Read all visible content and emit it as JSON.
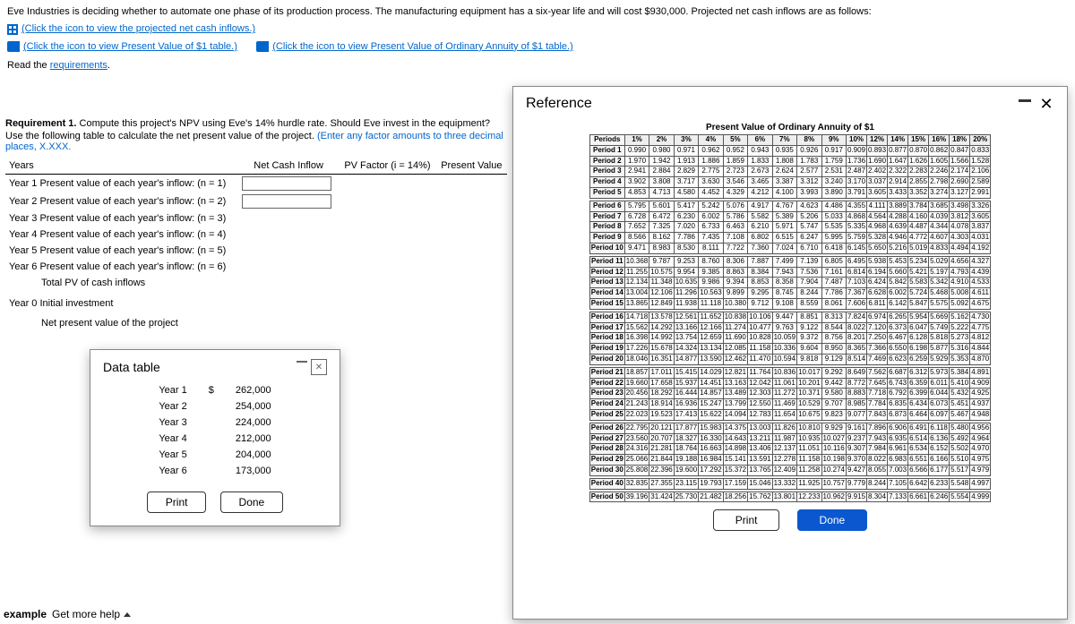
{
  "problem": {
    "intro": "Eve Industries is deciding whether to automate one phase of its production process. The manufacturing equipment has a six-year life and will cost $930,000. Projected net cash inflows are as follows:",
    "link_cash_inflows": "(Click the icon to view the projected net cash inflows.)",
    "link_pv1": "(Click the icon to view Present Value of $1 table.)",
    "link_pv_annuity": "(Click the icon to view Present Value of Ordinary Annuity of $1 table.)",
    "read_reqs": "Read the ",
    "reqs_link": "requirements",
    "req1_label": "Requirement 1.",
    "req1_text": " Compute this project's NPV using Eve's 14% hurdle rate. Should Eve invest in the equipment?",
    "instr": "Use the following table to calculate the net present value of the project. ",
    "instr_hint": "(Enter any factor amounts to three decimal places, X.XXX."
  },
  "headers": {
    "years": "Years",
    "ncf": "Net Cash Inflow",
    "pvf": "PV Factor (i = 14%)",
    "pv": "Present Value"
  },
  "rows": [
    "Year 1  Present value of each year's inflow: (n = 1)",
    "Year 2  Present value of each year's inflow: (n = 2)",
    "Year 3  Present value of each year's inflow: (n = 3)",
    "Year 4  Present value of each year's inflow: (n = 4)",
    "Year 5  Present value of each year's inflow: (n = 5)",
    "Year 6  Present value of each year's inflow: (n = 6)"
  ],
  "totals": {
    "totpv": "Total PV of cash inflows",
    "y0": "Year 0  Initial investment",
    "npv": "Net present value of the project"
  },
  "datatable": {
    "title": "Data table",
    "rows": [
      [
        "Year 1",
        "$",
        "262,000"
      ],
      [
        "Year 2",
        "",
        "254,000"
      ],
      [
        "Year 3",
        "",
        "224,000"
      ],
      [
        "Year 4",
        "",
        "212,000"
      ],
      [
        "Year 5",
        "",
        "204,000"
      ],
      [
        "Year 6",
        "",
        "173,000"
      ]
    ],
    "print": "Print",
    "done": "Done"
  },
  "reference": {
    "title": "Reference",
    "table_title": "Present Value of Ordinary Annuity of $1",
    "cols": [
      "Periods",
      "1%",
      "2%",
      "3%",
      "4%",
      "5%",
      "6%",
      "7%",
      "8%",
      "9%",
      "10%",
      "12%",
      "14%",
      "15%",
      "16%",
      "18%",
      "20%"
    ],
    "groups": [
      [
        [
          "Period 1",
          "0.990",
          "0.980",
          "0.971",
          "0.962",
          "0.952",
          "0.943",
          "0.935",
          "0.926",
          "0.917",
          "0.909",
          "0.893",
          "0.877",
          "0.870",
          "0.862",
          "0.847",
          "0.833"
        ],
        [
          "Period 2",
          "1.970",
          "1.942",
          "1.913",
          "1.886",
          "1.859",
          "1.833",
          "1.808",
          "1.783",
          "1.759",
          "1.736",
          "1.690",
          "1.647",
          "1.626",
          "1.605",
          "1.566",
          "1.528"
        ],
        [
          "Period 3",
          "2.941",
          "2.884",
          "2.829",
          "2.775",
          "2.723",
          "2.673",
          "2.624",
          "2.577",
          "2.531",
          "2.487",
          "2.402",
          "2.322",
          "2.283",
          "2.246",
          "2.174",
          "2.106"
        ],
        [
          "Period 4",
          "3.902",
          "3.808",
          "3.717",
          "3.630",
          "3.546",
          "3.465",
          "3.387",
          "3.312",
          "3.240",
          "3.170",
          "3.037",
          "2.914",
          "2.855",
          "2.798",
          "2.690",
          "2.589"
        ],
        [
          "Period 5",
          "4.853",
          "4.713",
          "4.580",
          "4.452",
          "4.329",
          "4.212",
          "4.100",
          "3.993",
          "3.890",
          "3.791",
          "3.605",
          "3.433",
          "3.352",
          "3.274",
          "3.127",
          "2.991"
        ]
      ],
      [
        [
          "Period 6",
          "5.795",
          "5.601",
          "5.417",
          "5.242",
          "5.076",
          "4.917",
          "4.767",
          "4.623",
          "4.486",
          "4.355",
          "4.111",
          "3.889",
          "3.784",
          "3.685",
          "3.498",
          "3.326"
        ],
        [
          "Period 7",
          "6.728",
          "6.472",
          "6.230",
          "6.002",
          "5.786",
          "5.582",
          "5.389",
          "5.206",
          "5.033",
          "4.868",
          "4.564",
          "4.288",
          "4.160",
          "4.039",
          "3.812",
          "3.605"
        ],
        [
          "Period 8",
          "7.652",
          "7.325",
          "7.020",
          "6.733",
          "6.463",
          "6.210",
          "5.971",
          "5.747",
          "5.535",
          "5.335",
          "4.968",
          "4.639",
          "4.487",
          "4.344",
          "4.078",
          "3.837"
        ],
        [
          "Period 9",
          "8.566",
          "8.162",
          "7.786",
          "7.435",
          "7.108",
          "6.802",
          "6.515",
          "6.247",
          "5.995",
          "5.759",
          "5.328",
          "4.946",
          "4.772",
          "4.607",
          "4.303",
          "4.031"
        ],
        [
          "Period 10",
          "9.471",
          "8.983",
          "8.530",
          "8.111",
          "7.722",
          "7.360",
          "7.024",
          "6.710",
          "6.418",
          "6.145",
          "5.650",
          "5.216",
          "5.019",
          "4.833",
          "4.494",
          "4.192"
        ]
      ],
      [
        [
          "Period 11",
          "10.368",
          "9.787",
          "9.253",
          "8.760",
          "8.306",
          "7.887",
          "7.499",
          "7.139",
          "6.805",
          "6.495",
          "5.938",
          "5.453",
          "5.234",
          "5.029",
          "4.656",
          "4.327"
        ],
        [
          "Period 12",
          "11.255",
          "10.575",
          "9.954",
          "9.385",
          "8.863",
          "8.384",
          "7.943",
          "7.536",
          "7.161",
          "6.814",
          "6.194",
          "5.660",
          "5.421",
          "5.197",
          "4.793",
          "4.439"
        ],
        [
          "Period 13",
          "12.134",
          "11.348",
          "10.635",
          "9.986",
          "9.394",
          "8.853",
          "8.358",
          "7.904",
          "7.487",
          "7.103",
          "6.424",
          "5.842",
          "5.583",
          "5.342",
          "4.910",
          "4.533"
        ],
        [
          "Period 14",
          "13.004",
          "12.106",
          "11.296",
          "10.563",
          "9.899",
          "9.295",
          "8.745",
          "8.244",
          "7.786",
          "7.367",
          "6.628",
          "6.002",
          "5.724",
          "5.468",
          "5.008",
          "4.611"
        ],
        [
          "Period 15",
          "13.865",
          "12.849",
          "11.938",
          "11.118",
          "10.380",
          "9.712",
          "9.108",
          "8.559",
          "8.061",
          "7.606",
          "6.811",
          "6.142",
          "5.847",
          "5.575",
          "5.092",
          "4.675"
        ]
      ],
      [
        [
          "Period 16",
          "14.718",
          "13.578",
          "12.561",
          "11.652",
          "10.838",
          "10.106",
          "9.447",
          "8.851",
          "8.313",
          "7.824",
          "6.974",
          "6.265",
          "5.954",
          "5.669",
          "5.162",
          "4.730"
        ],
        [
          "Period 17",
          "15.562",
          "14.292",
          "13.166",
          "12.166",
          "11.274",
          "10.477",
          "9.763",
          "9.122",
          "8.544",
          "8.022",
          "7.120",
          "6.373",
          "6.047",
          "5.749",
          "5.222",
          "4.775"
        ],
        [
          "Period 18",
          "16.398",
          "14.992",
          "13.754",
          "12.659",
          "11.690",
          "10.828",
          "10.059",
          "9.372",
          "8.756",
          "8.201",
          "7.250",
          "6.467",
          "6.128",
          "5.818",
          "5.273",
          "4.812"
        ],
        [
          "Period 19",
          "17.226",
          "15.678",
          "14.324",
          "13.134",
          "12.085",
          "11.158",
          "10.336",
          "9.604",
          "8.950",
          "8.365",
          "7.366",
          "6.550",
          "6.198",
          "5.877",
          "5.316",
          "4.844"
        ],
        [
          "Period 20",
          "18.046",
          "16.351",
          "14.877",
          "13.590",
          "12.462",
          "11.470",
          "10.594",
          "9.818",
          "9.129",
          "8.514",
          "7.469",
          "6.623",
          "6.259",
          "5.929",
          "5.353",
          "4.870"
        ]
      ],
      [
        [
          "Period 21",
          "18.857",
          "17.011",
          "15.415",
          "14.029",
          "12.821",
          "11.764",
          "10.836",
          "10.017",
          "9.292",
          "8.649",
          "7.562",
          "6.687",
          "6.312",
          "5.973",
          "5.384",
          "4.891"
        ],
        [
          "Period 22",
          "19.660",
          "17.658",
          "15.937",
          "14.451",
          "13.163",
          "12.042",
          "11.061",
          "10.201",
          "9.442",
          "8.772",
          "7.645",
          "6.743",
          "6.359",
          "6.011",
          "5.410",
          "4.909"
        ],
        [
          "Period 23",
          "20.456",
          "18.292",
          "16.444",
          "14.857",
          "13.489",
          "12.303",
          "11.272",
          "10.371",
          "9.580",
          "8.883",
          "7.718",
          "6.792",
          "6.399",
          "6.044",
          "5.432",
          "4.925"
        ],
        [
          "Period 24",
          "21.243",
          "18.914",
          "16.936",
          "15.247",
          "13.799",
          "12.550",
          "11.469",
          "10.529",
          "9.707",
          "8.985",
          "7.784",
          "6.835",
          "6.434",
          "6.073",
          "5.451",
          "4.937"
        ],
        [
          "Period 25",
          "22.023",
          "19.523",
          "17.413",
          "15.622",
          "14.094",
          "12.783",
          "11.654",
          "10.675",
          "9.823",
          "9.077",
          "7.843",
          "6.873",
          "6.464",
          "6.097",
          "5.467",
          "4.948"
        ]
      ],
      [
        [
          "Period 26",
          "22.795",
          "20.121",
          "17.877",
          "15.983",
          "14.375",
          "13.003",
          "11.826",
          "10.810",
          "9.929",
          "9.161",
          "7.896",
          "6.906",
          "6.491",
          "6.118",
          "5.480",
          "4.956"
        ],
        [
          "Period 27",
          "23.560",
          "20.707",
          "18.327",
          "16.330",
          "14.643",
          "13.211",
          "11.987",
          "10.935",
          "10.027",
          "9.237",
          "7.943",
          "6.935",
          "6.514",
          "6.136",
          "5.492",
          "4.964"
        ],
        [
          "Period 28",
          "24.316",
          "21.281",
          "18.764",
          "16.663",
          "14.898",
          "13.406",
          "12.137",
          "11.051",
          "10.116",
          "9.307",
          "7.984",
          "6.961",
          "6.534",
          "6.152",
          "5.502",
          "4.970"
        ],
        [
          "Period 29",
          "25.066",
          "21.844",
          "19.188",
          "16.984",
          "15.141",
          "13.591",
          "12.278",
          "11.158",
          "10.198",
          "9.370",
          "8.022",
          "6.983",
          "6.551",
          "6.166",
          "5.510",
          "4.975"
        ],
        [
          "Period 30",
          "25.808",
          "22.396",
          "19.600",
          "17.292",
          "15.372",
          "13.765",
          "12.409",
          "11.258",
          "10.274",
          "9.427",
          "8.055",
          "7.003",
          "6.566",
          "6.177",
          "5.517",
          "4.979"
        ]
      ],
      [
        [
          "Period 40",
          "32.835",
          "27.355",
          "23.115",
          "19.793",
          "17.159",
          "15.046",
          "13.332",
          "11.925",
          "10.757",
          "9.779",
          "8.244",
          "7.105",
          "6.642",
          "6.233",
          "5.548",
          "4.997"
        ]
      ],
      [
        [
          "Period 50",
          "39.196",
          "31.424",
          "25.730",
          "21.482",
          "18.256",
          "15.762",
          "13.801",
          "12.233",
          "10.962",
          "9.915",
          "8.304",
          "7.133",
          "6.661",
          "6.246",
          "5.554",
          "4.999"
        ]
      ]
    ],
    "print": "Print",
    "done": "Done"
  },
  "footer": {
    "example": "example",
    "help": "Get more help"
  }
}
